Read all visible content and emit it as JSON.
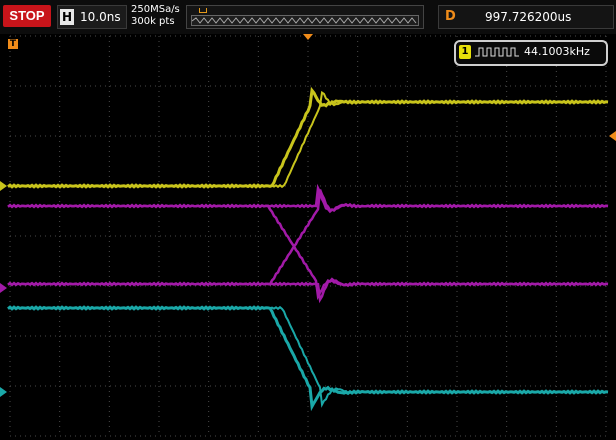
{
  "status": {
    "run_state": "STOP"
  },
  "timebase": {
    "letter": "H",
    "value": "10.0ns"
  },
  "acquisition": {
    "sample_rate": "250MSa/s",
    "memory_depth": "300k pts"
  },
  "delay": {
    "letter": "D",
    "value": "997.726200us"
  },
  "measurement": {
    "channel": "1",
    "icon": "square-wave-icon",
    "value": "44.1003kHz"
  },
  "trigger": {
    "marker": "T"
  },
  "colors": {
    "ch1": "#c8c41c",
    "ch2": "#a21aa8",
    "ch3": "#a21aa8",
    "ch4": "#1aa8a8",
    "run_state": "#c8141a",
    "trigger": "#f08c1a",
    "grid": "#4a4a4a"
  }
}
